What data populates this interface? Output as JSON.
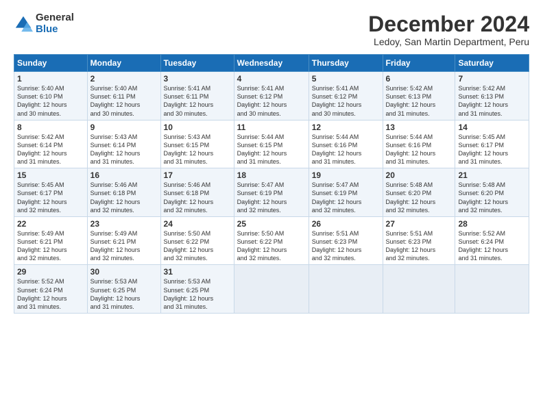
{
  "logo": {
    "general": "General",
    "blue": "Blue"
  },
  "title": "December 2024",
  "subtitle": "Ledoy, San Martin Department, Peru",
  "header_days": [
    "Sunday",
    "Monday",
    "Tuesday",
    "Wednesday",
    "Thursday",
    "Friday",
    "Saturday"
  ],
  "weeks": [
    [
      {
        "day": "1",
        "sunrise": "5:40 AM",
        "sunset": "6:10 PM",
        "daylight": "12 hours and 30 minutes."
      },
      {
        "day": "2",
        "sunrise": "5:40 AM",
        "sunset": "6:11 PM",
        "daylight": "12 hours and 30 minutes."
      },
      {
        "day": "3",
        "sunrise": "5:41 AM",
        "sunset": "6:11 PM",
        "daylight": "12 hours and 30 minutes."
      },
      {
        "day": "4",
        "sunrise": "5:41 AM",
        "sunset": "6:12 PM",
        "daylight": "12 hours and 30 minutes."
      },
      {
        "day": "5",
        "sunrise": "5:41 AM",
        "sunset": "6:12 PM",
        "daylight": "12 hours and 30 minutes."
      },
      {
        "day": "6",
        "sunrise": "5:42 AM",
        "sunset": "6:13 PM",
        "daylight": "12 hours and 31 minutes."
      },
      {
        "day": "7",
        "sunrise": "5:42 AM",
        "sunset": "6:13 PM",
        "daylight": "12 hours and 31 minutes."
      }
    ],
    [
      {
        "day": "8",
        "sunrise": "5:42 AM",
        "sunset": "6:14 PM",
        "daylight": "12 hours and 31 minutes."
      },
      {
        "day": "9",
        "sunrise": "5:43 AM",
        "sunset": "6:14 PM",
        "daylight": "12 hours and 31 minutes."
      },
      {
        "day": "10",
        "sunrise": "5:43 AM",
        "sunset": "6:15 PM",
        "daylight": "12 hours and 31 minutes."
      },
      {
        "day": "11",
        "sunrise": "5:44 AM",
        "sunset": "6:15 PM",
        "daylight": "12 hours and 31 minutes."
      },
      {
        "day": "12",
        "sunrise": "5:44 AM",
        "sunset": "6:16 PM",
        "daylight": "12 hours and 31 minutes."
      },
      {
        "day": "13",
        "sunrise": "5:44 AM",
        "sunset": "6:16 PM",
        "daylight": "12 hours and 31 minutes."
      },
      {
        "day": "14",
        "sunrise": "5:45 AM",
        "sunset": "6:17 PM",
        "daylight": "12 hours and 31 minutes."
      }
    ],
    [
      {
        "day": "15",
        "sunrise": "5:45 AM",
        "sunset": "6:17 PM",
        "daylight": "12 hours and 32 minutes."
      },
      {
        "day": "16",
        "sunrise": "5:46 AM",
        "sunset": "6:18 PM",
        "daylight": "12 hours and 32 minutes."
      },
      {
        "day": "17",
        "sunrise": "5:46 AM",
        "sunset": "6:18 PM",
        "daylight": "12 hours and 32 minutes."
      },
      {
        "day": "18",
        "sunrise": "5:47 AM",
        "sunset": "6:19 PM",
        "daylight": "12 hours and 32 minutes."
      },
      {
        "day": "19",
        "sunrise": "5:47 AM",
        "sunset": "6:19 PM",
        "daylight": "12 hours and 32 minutes."
      },
      {
        "day": "20",
        "sunrise": "5:48 AM",
        "sunset": "6:20 PM",
        "daylight": "12 hours and 32 minutes."
      },
      {
        "day": "21",
        "sunrise": "5:48 AM",
        "sunset": "6:20 PM",
        "daylight": "12 hours and 32 minutes."
      }
    ],
    [
      {
        "day": "22",
        "sunrise": "5:49 AM",
        "sunset": "6:21 PM",
        "daylight": "12 hours and 32 minutes."
      },
      {
        "day": "23",
        "sunrise": "5:49 AM",
        "sunset": "6:21 PM",
        "daylight": "12 hours and 32 minutes."
      },
      {
        "day": "24",
        "sunrise": "5:50 AM",
        "sunset": "6:22 PM",
        "daylight": "12 hours and 32 minutes."
      },
      {
        "day": "25",
        "sunrise": "5:50 AM",
        "sunset": "6:22 PM",
        "daylight": "12 hours and 32 minutes."
      },
      {
        "day": "26",
        "sunrise": "5:51 AM",
        "sunset": "6:23 PM",
        "daylight": "12 hours and 32 minutes."
      },
      {
        "day": "27",
        "sunrise": "5:51 AM",
        "sunset": "6:23 PM",
        "daylight": "12 hours and 32 minutes."
      },
      {
        "day": "28",
        "sunrise": "5:52 AM",
        "sunset": "6:24 PM",
        "daylight": "12 hours and 31 minutes."
      }
    ],
    [
      {
        "day": "29",
        "sunrise": "5:52 AM",
        "sunset": "6:24 PM",
        "daylight": "12 hours and 31 minutes."
      },
      {
        "day": "30",
        "sunrise": "5:53 AM",
        "sunset": "6:25 PM",
        "daylight": "12 hours and 31 minutes."
      },
      {
        "day": "31",
        "sunrise": "5:53 AM",
        "sunset": "6:25 PM",
        "daylight": "12 hours and 31 minutes."
      },
      null,
      null,
      null,
      null
    ]
  ]
}
